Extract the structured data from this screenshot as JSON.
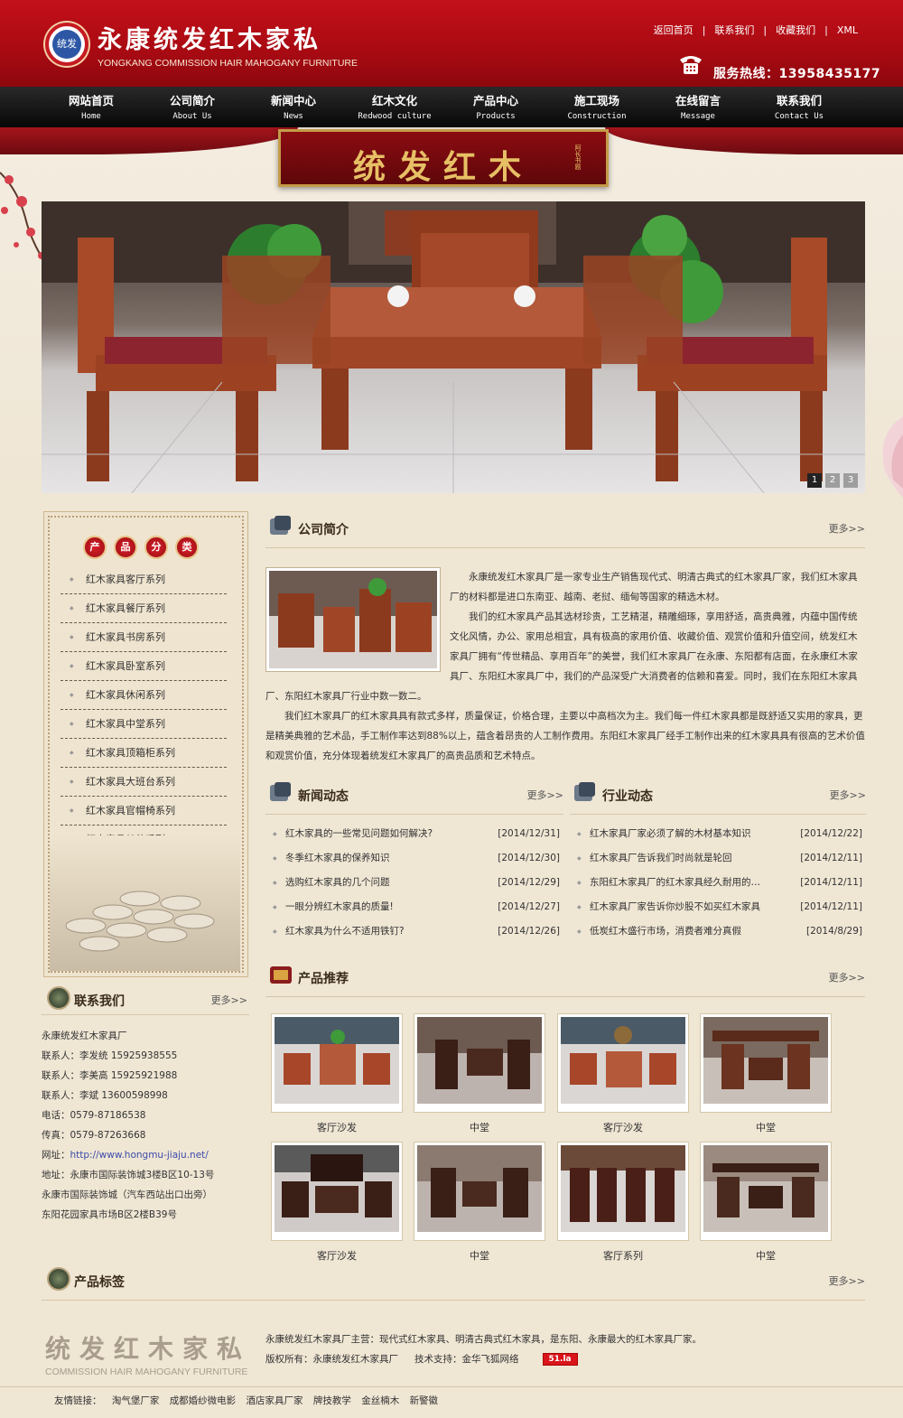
{
  "header": {
    "logo_badge_text": "统发",
    "site_name": "永康统发红木家私",
    "site_name_en": "YONGKANG COMMISSION HAIR MAHOGANY FURNITURE",
    "top_links": [
      "返回首页",
      "联系我们",
      "收藏我们",
      "XML"
    ],
    "separator": "|",
    "hotline": "服务热线：13958435177"
  },
  "nav": [
    {
      "cn": "网站首页",
      "en": "Home"
    },
    {
      "cn": "公司简介",
      "en": "About Us"
    },
    {
      "cn": "新闻中心",
      "en": "News"
    },
    {
      "cn": "红木文化",
      "en": "Redwood culture"
    },
    {
      "cn": "产品中心",
      "en": "Products"
    },
    {
      "cn": "施工现场",
      "en": "Construction"
    },
    {
      "cn": "在线留言",
      "en": "Message"
    },
    {
      "cn": "联系我们",
      "en": "Contact Us"
    }
  ],
  "banner": {
    "title": "统发红木",
    "title_sub": "阿长书题",
    "slides": [
      "1",
      "2",
      "3"
    ],
    "active_slide": 1
  },
  "sidebar": {
    "category_heading": [
      "产",
      "品",
      "分",
      "类"
    ],
    "categories": [
      "红木家具客厅系列",
      "红木家具餐厅系列",
      "红木家具书房系列",
      "红木家具卧室系列",
      "红木家具休闲系列",
      "红木家具中堂系列",
      "红木家具顶箱柜系列",
      "红木家具大班台系列",
      "红木家具官帽椅系列",
      "红木家具其他系列"
    ],
    "contact_title": "联系我们",
    "contact_more": "更多>>",
    "contact_lines": [
      "永康统发红木家具厂",
      "联系人：李发统 15925938555",
      "联系人：李美高 15925921988",
      "联系人：李斌 13600598998",
      "电话：0579-87186538",
      "传真：0579-87263668"
    ],
    "contact_url_label": "网址：",
    "contact_url": "http://www.hongmu-jiaju.net/",
    "contact_address": [
      "地址：永康市国际装饰城3楼B区10-13号",
      "永康市国际装饰城（汽车西站出口出旁）",
      "东阳花园家具市场B区2楼B39号"
    ]
  },
  "about": {
    "title": "公司简介",
    "more": "更多>>",
    "paragraphs": [
      "永康统发红木家具厂是一家专业生产销售现代式、明清古典式的红木家具厂家，我们红木家具厂的材料都是进口东南亚、越南、老挝、缅甸等国家的精选木材。",
      "我们的红木家具产品其选材珍贵，工艺精湛，精雕细琢，享用舒适，高贵典雅，内蕴中国传统文化风情，办公、家用总相宜，具有极高的家用价值、收藏价值、观赏价值和升值空间，统发红木家具厂拥有“传世精品、享用百年”的美誉，我们红木家具厂在永康、东阳都有店面，在永康红木家具厂、东阳红木家具厂中，我们的产品深受广大消费者的信赖和喜爱。同时，我们在东阳红木家具厂、东阳红木家具厂行业中数一数二。",
      "我们红木家具厂的红木家具具有款式多样，质量保证，价格合理，主要以中高档次为主。我们每一件红木家具都是既舒适又实用的家具，更是精美典雅的艺术品，手工制作率达到88%以上，蕴含着昂贵的人工制作费用。东阳红木家具厂经手工制作出来的红木家具具有很高的艺术价值和观赏价值，充分体现着统发红木家具厂的高贵品质和艺术特点。"
    ]
  },
  "news": {
    "title": "新闻动态",
    "more": "更多>>",
    "items": [
      {
        "title": "红木家具的一些常见问题如何解决?",
        "date": "[2014/12/31]"
      },
      {
        "title": "冬季红木家具的保养知识",
        "date": "[2014/12/30]"
      },
      {
        "title": "选购红木家具的几个问题",
        "date": "[2014/12/29]"
      },
      {
        "title": "一眼分辨红木家具的质量!",
        "date": "[2014/12/27]"
      },
      {
        "title": "红木家具为什么不适用铁钉?",
        "date": "[2014/12/26]"
      }
    ]
  },
  "industry": {
    "title": "行业动态",
    "more": "更多>>",
    "items": [
      {
        "title": "红木家具厂家必须了解的木材基本知识",
        "date": "[2014/12/22]"
      },
      {
        "title": "红木家具厂告诉我们时尚就是轮回",
        "date": "[2014/12/11]"
      },
      {
        "title": "东阳红木家具厂的红木家具经久耐用的…",
        "date": "[2014/12/11]"
      },
      {
        "title": "红木家具厂家告诉你炒股不如买红木家具",
        "date": "[2014/12/11]"
      },
      {
        "title": "低炭红木盛行市场，消费者难分真假",
        "date": "[2014/8/29]"
      }
    ]
  },
  "products": {
    "title": "产品推荐",
    "more": "更多>>",
    "items": [
      {
        "caption": "客厅沙发",
        "tone": "red-sofa"
      },
      {
        "caption": "中堂",
        "tone": "dark-hall"
      },
      {
        "caption": "客厅沙发",
        "tone": "red-sofa"
      },
      {
        "caption": "中堂",
        "tone": "brown-hall"
      },
      {
        "caption": "客厅沙发",
        "tone": "dark-sofa"
      },
      {
        "caption": "中堂",
        "tone": "dark-hall"
      },
      {
        "caption": "客厅系列",
        "tone": "dark-chairs"
      },
      {
        "caption": "中堂",
        "tone": "dark-hall"
      }
    ]
  },
  "tags": {
    "title": "产品标签",
    "more": "更多>>"
  },
  "footer": {
    "brand": "统发红木家私",
    "brand_en": "COMMISSION HAIR MAHOGANY FURNITURE",
    "line1": "永康统发红木家具厂主营：现代式红木家具、明清古典式红木家具，是东阳、永康最大的红木家具厂家。",
    "copyright": "版权所有：永康统发红木家具厂",
    "tech": "技术支持：金华飞狐网络",
    "badge": "51.la",
    "friend_label": "友情链接：",
    "friend_links": [
      "淘气堡厂家",
      "成都婚纱微电影",
      "酒店家具厂家",
      "牌技教学",
      "金丝楠木",
      "新警徽"
    ]
  },
  "colors": {
    "header_red": "#b00c14",
    "nav_black": "#111111",
    "page_bg": "#efe6d4",
    "heading_text": "#3a2a1a"
  }
}
